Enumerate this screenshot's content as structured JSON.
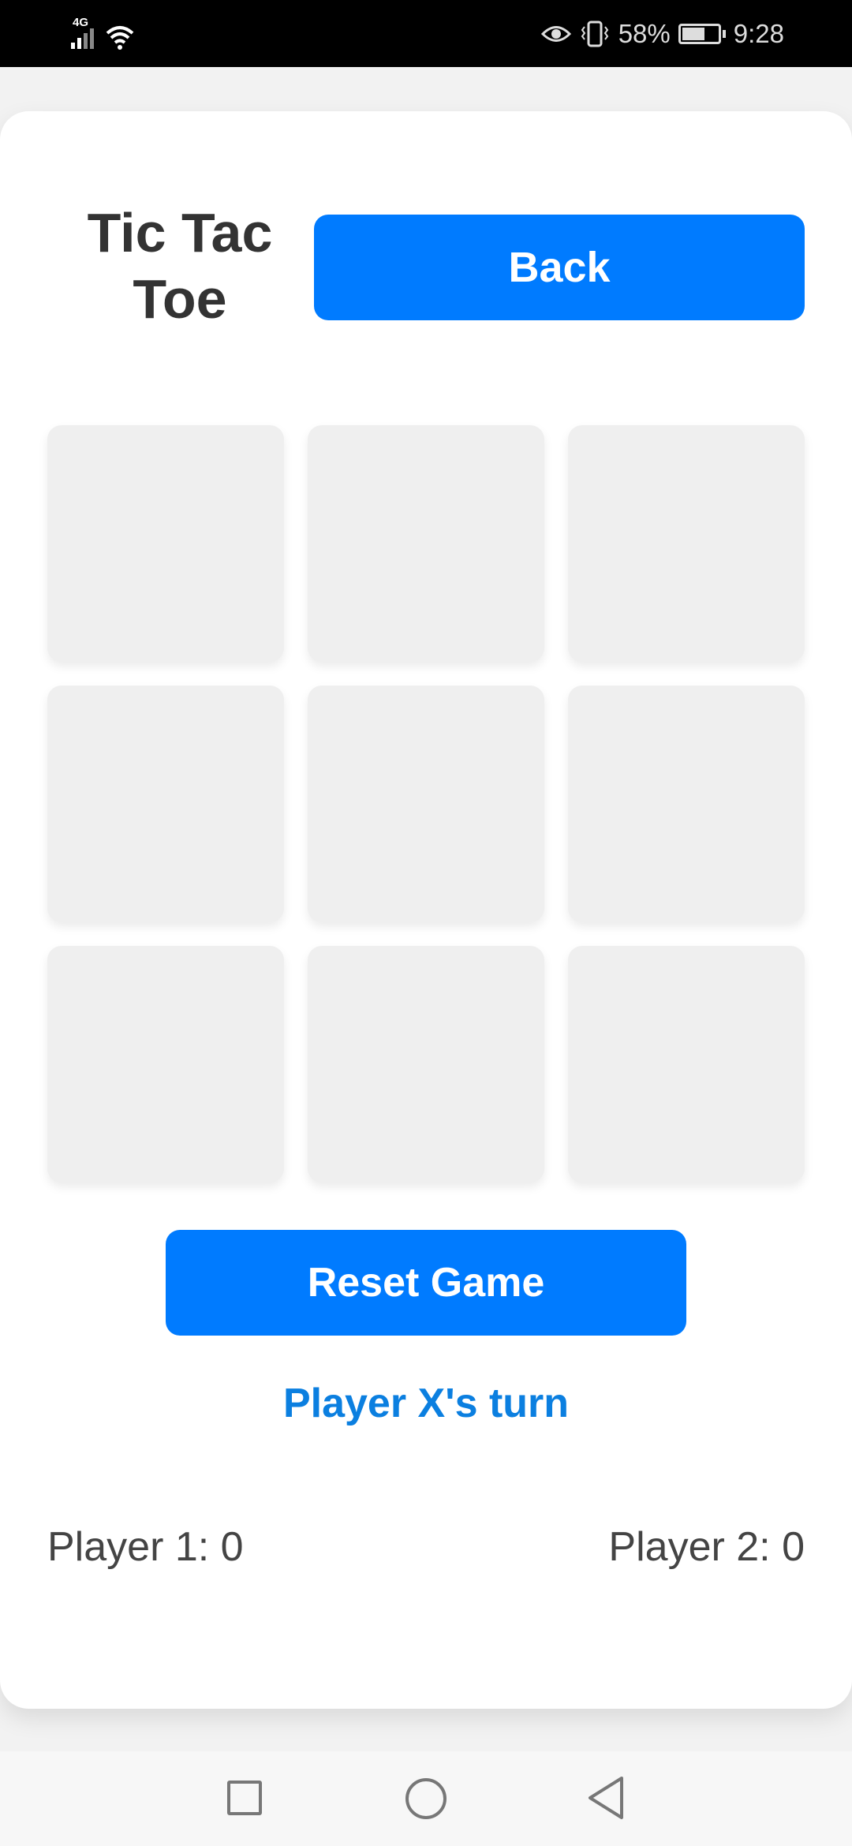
{
  "status_bar": {
    "network": "4G",
    "battery_percent": "58%",
    "time": "9:28",
    "battery_level": 0.58
  },
  "header": {
    "title": "Tic Tac Toe",
    "back_label": "Back"
  },
  "board": {
    "cells": [
      "",
      "",
      "",
      "",
      "",
      "",
      "",
      "",
      ""
    ]
  },
  "controls": {
    "reset_label": "Reset Game"
  },
  "status": {
    "turn_text": "Player X's turn"
  },
  "scores": {
    "player1": "Player 1: 0",
    "player2": "Player 2: 0"
  },
  "colors": {
    "accent": "#007bff",
    "turn_text": "#0b7fe0",
    "cell_bg": "#efefef"
  },
  "nav": {
    "icons": [
      "recent-apps-icon",
      "home-icon",
      "back-icon"
    ]
  }
}
